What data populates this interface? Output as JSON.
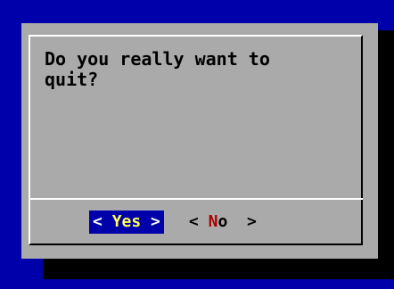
{
  "dialog": {
    "message": "Do you really want to\nquit?",
    "buttons": {
      "yes": {
        "left_bracket": "< ",
        "hotkey": "Y",
        "rest": "es",
        "right_bracket": " >",
        "selected": true
      },
      "no": {
        "left_bracket": "< ",
        "hotkey": "N",
        "rest": "o",
        "right_bracket": "  >",
        "selected": false
      }
    }
  },
  "colors": {
    "background": "#0000aa",
    "dialog_bg": "#aaaaaa",
    "shadow": "#000000",
    "selected_bg": "#0000aa",
    "selected_text": "#ffff55",
    "unselected_hotkey": "#aa0000"
  }
}
